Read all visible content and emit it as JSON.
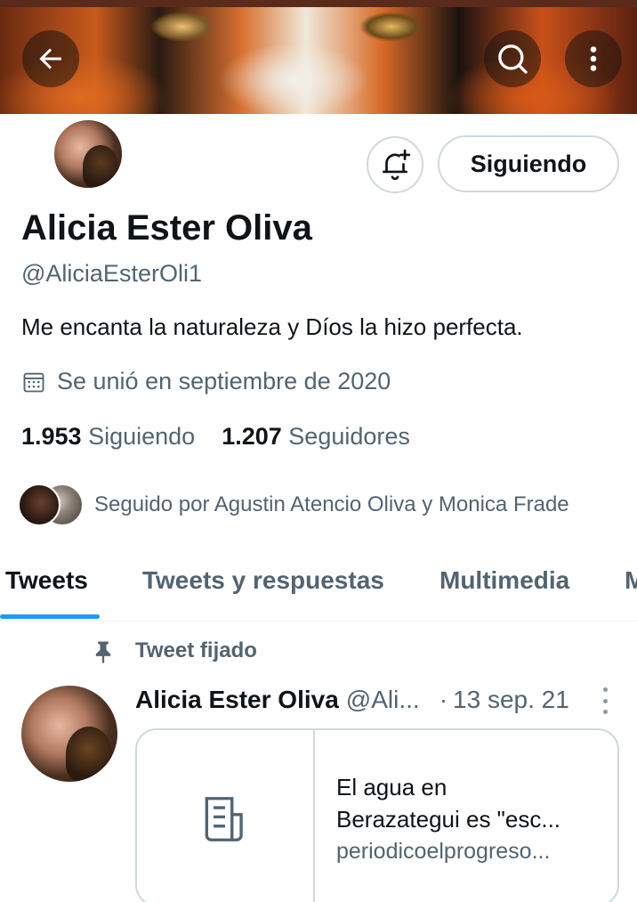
{
  "header": {
    "back_icon": "arrow-left-icon",
    "search_icon": "search-icon",
    "more_icon": "more-vertical-icon"
  },
  "profile": {
    "name": "Alicia Ester Oliva",
    "handle": "@AliciaEsterOli1",
    "bio": "Me encanta la naturaleza y Díos la hizo perfecta.",
    "joined": "Se unió en septiembre de 2020",
    "following_count": "1.953",
    "following_label": "Siguiendo",
    "followers_count": "1.207",
    "followers_label": "Seguidores",
    "followed_by": "Seguido por Agustin Atencio Oliva y Monica Frade",
    "follow_button_label": "Siguiendo",
    "notify_icon": "bell-plus-icon"
  },
  "tabs": [
    {
      "label": "Tweets",
      "active": true
    },
    {
      "label": "Tweets y respuestas",
      "active": false
    },
    {
      "label": "Multimedia",
      "active": false
    },
    {
      "label": "M",
      "active": false
    }
  ],
  "pinned_tweet": {
    "pinned_label": "Tweet fijado",
    "author_name": "Alicia Ester Oliva",
    "author_handle": "@Ali...",
    "separator": "·",
    "date": "13 sep. 21",
    "card": {
      "title_line1": "El agua en",
      "title_line2": "Berazategui es \"esc...",
      "domain": "periodicoelprogreso..."
    }
  },
  "colors": {
    "accent": "#1d9bf0",
    "text_primary": "#0f1419",
    "text_secondary": "#536471",
    "border": "#cfd9de"
  }
}
